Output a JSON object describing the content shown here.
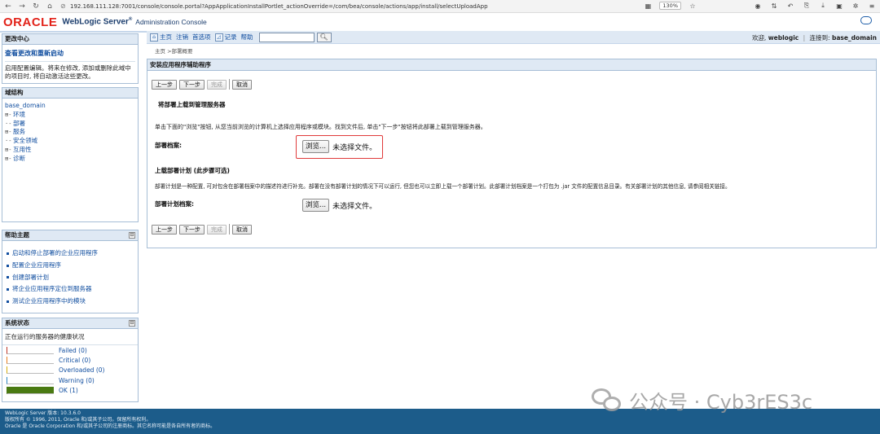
{
  "browser": {
    "url": "192.168.111.128:7001/console/console.portal?AppApplicationInstallPortlet_actionOverride=/com/bea/console/actions/app/install/selectUploadApp",
    "zoom": "130%"
  },
  "header": {
    "logo": "ORACLE",
    "product": "WebLogic Server",
    "reg": "®",
    "console": "Administration Console"
  },
  "change_center": {
    "title": "更改中心",
    "link": "查看更改和重新启动",
    "description": "启用配置编辑。将来在修改, 添加或删除此域中的项目时, 将自动激活这些更改。"
  },
  "domain_structure": {
    "title": "域结构",
    "root": "base_domain",
    "items": [
      {
        "prefix": "⊞-",
        "label": "环境"
      },
      {
        "prefix": "·-",
        "label": "部署"
      },
      {
        "prefix": "⊞-",
        "label": "服务"
      },
      {
        "prefix": "·-",
        "label": "安全领域"
      },
      {
        "prefix": "⊞-",
        "label": "互用性"
      },
      {
        "prefix": "⊞-",
        "label": "诊断"
      }
    ]
  },
  "help_topics": {
    "title": "帮助主题",
    "collapse": "⊟",
    "items": [
      "启动和停止部署的企业应用程序",
      "配置企业应用程序",
      "创建部署计划",
      "将企业应用程序定位到服务器",
      "测试企业应用程序中的模块"
    ]
  },
  "system_status": {
    "title": "系统状态",
    "collapse": "⊟",
    "subtitle": "正在运行的服务器的健康状况",
    "rows": [
      {
        "label": "Failed (0)",
        "fraction": 0,
        "color": "#c0392b"
      },
      {
        "label": "Critical (0)",
        "fraction": 0,
        "color": "#e67e22"
      },
      {
        "label": "Overloaded (0)",
        "fraction": 0,
        "color": "#d4ac0d"
      },
      {
        "label": "Warning (0)",
        "fraction": 0,
        "color": "#2e86c1"
      },
      {
        "label": "OK (1)",
        "fraction": 1,
        "color": "#4a7a12"
      }
    ]
  },
  "toolbar": {
    "home": "主页",
    "logout": "注销",
    "preferences": "首选项",
    "record": "记录",
    "help": "帮助",
    "search_placeholder": "",
    "welcome_prefix": "欢迎,",
    "user": "weblogic",
    "connected_prefix": "连接到:",
    "domain": "base_domain"
  },
  "breadcrumb": "主页 >部署概要",
  "assistant": {
    "title": "安装应用程序辅助程序",
    "buttons": {
      "back": "上一步",
      "next": "下一步",
      "finish": "完成",
      "cancel": "取消"
    },
    "upload_section_title": "将部署上载到管理服务器",
    "upload_instruction": "单击下面的\"浏览\"按钮, 从您当前浏览的计算机上选择应用程序或模块。找到文件后, 单击\"下一步\"按钮将此部署上载到管理服务器。",
    "archive_label": "部署档案:",
    "browse_label": "浏览...",
    "no_file": "未选择文件。",
    "plan_section_title": "上载部署计划 (此步骤可选)",
    "plan_description": "部署计划是一种配置, 可对包含在部署档案中的描述符进行补充。部署在没有部署计划的情况下可以运行, 但您也可以立即上载一个部署计划。此部署计划档案是一个打包为 .jar 文件的配置信息目录。有关部署计划的其他信息, 请参阅相关链接。",
    "plan_label": "部署计划档案:"
  },
  "footer": {
    "line1": "WebLogic Server 版本: 10.3.6.0",
    "line2": "版权所有 © 1996, 2011, Oracle 和/或其子公司。保留所有权利。",
    "line3": "Oracle 是 Oracle Corporation 和/或其子公司的注册商标。其它名称可能是各自所有者的商标。"
  },
  "watermark": "公众号 · Cyb3rES3c"
}
